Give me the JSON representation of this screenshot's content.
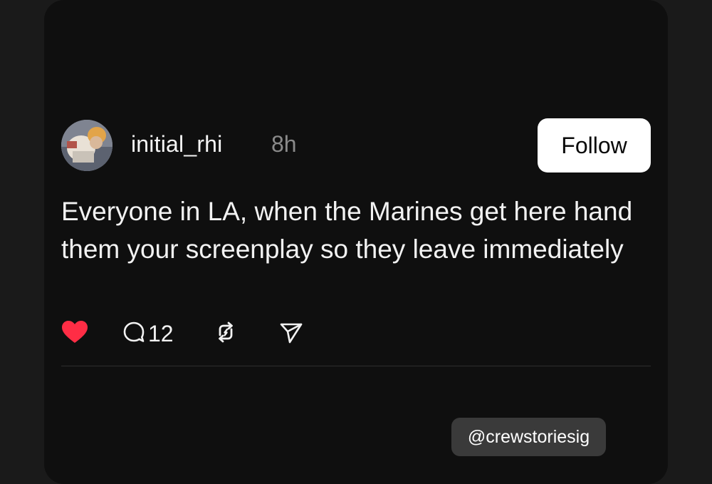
{
  "post": {
    "username": "initial_rhi",
    "timestamp": "8h",
    "follow_label": "Follow",
    "text": "Everyone in LA, when the Marines get here hand them your screenplay so they leave immediately",
    "liked": true,
    "reply_count": "12"
  },
  "icons": {
    "like": "heart-icon",
    "reply": "comment-icon",
    "repost": "repost-icon",
    "share": "send-icon"
  },
  "colors": {
    "like": "#ff2d45",
    "background": "#0f0f0f",
    "text": "#f2f2f2",
    "muted": "#8a8a8a"
  },
  "watermark": {
    "text": "@crewstoriesig"
  }
}
